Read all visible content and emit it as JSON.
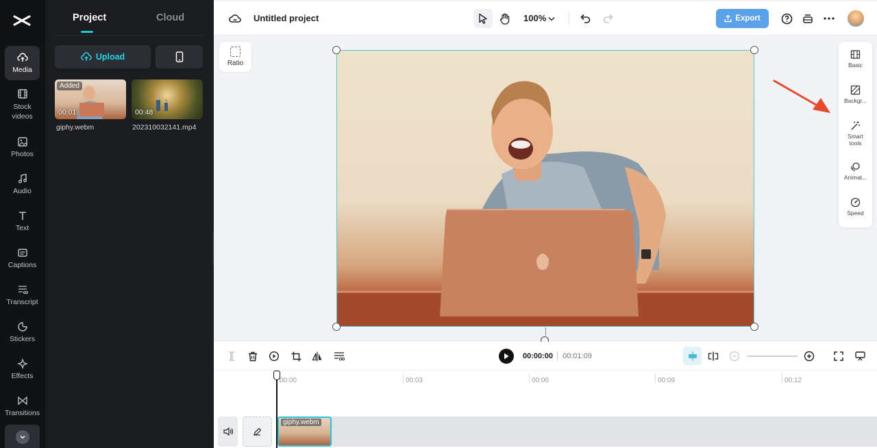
{
  "rail": {
    "items": [
      {
        "label": "Media",
        "icon": "cloud-upload-icon"
      },
      {
        "label": "Stock\nvideos",
        "icon": "film-icon"
      },
      {
        "label": "Photos",
        "icon": "image-icon"
      },
      {
        "label": "Audio",
        "icon": "music-icon"
      },
      {
        "label": "Text",
        "icon": "text-icon"
      },
      {
        "label": "Captions",
        "icon": "captions-icon"
      },
      {
        "label": "Transcript",
        "icon": "transcript-icon"
      },
      {
        "label": "Stickers",
        "icon": "sticker-icon"
      },
      {
        "label": "Effects",
        "icon": "sparkle-icon"
      },
      {
        "label": "Transitions",
        "icon": "transition-icon"
      }
    ]
  },
  "panel": {
    "tabs": [
      {
        "label": "Project"
      },
      {
        "label": "Cloud"
      }
    ],
    "upload_label": "Upload",
    "media": [
      {
        "name": "giphy.webm",
        "duration": "00:01",
        "badge": "Added"
      },
      {
        "name": "202310032141.mp4",
        "duration": "00:48"
      }
    ]
  },
  "topbar": {
    "title": "Untitled project",
    "zoom": "100%",
    "export_label": "Export"
  },
  "canvas": {
    "ratio_label": "Ratio"
  },
  "side_panel": {
    "items": [
      {
        "label": "Basic",
        "icon": "basic-icon"
      },
      {
        "label": "Backgr...",
        "icon": "background-icon"
      },
      {
        "label": "Smart\ntools",
        "icon": "magic-wand-icon"
      },
      {
        "label": "Animat...",
        "icon": "animation-icon"
      },
      {
        "label": "Speed",
        "icon": "speed-icon"
      }
    ]
  },
  "timeline": {
    "current_time": "00:00:00",
    "total_time": "00:01:09",
    "ticks": [
      "00:00",
      "00:03",
      "00:06",
      "00:09",
      "00:12"
    ],
    "clip_label": "giphy.webm"
  },
  "colors": {
    "accent": "#22c4d6",
    "export": "#5aa1e9",
    "arrow": "#e64a2e"
  }
}
